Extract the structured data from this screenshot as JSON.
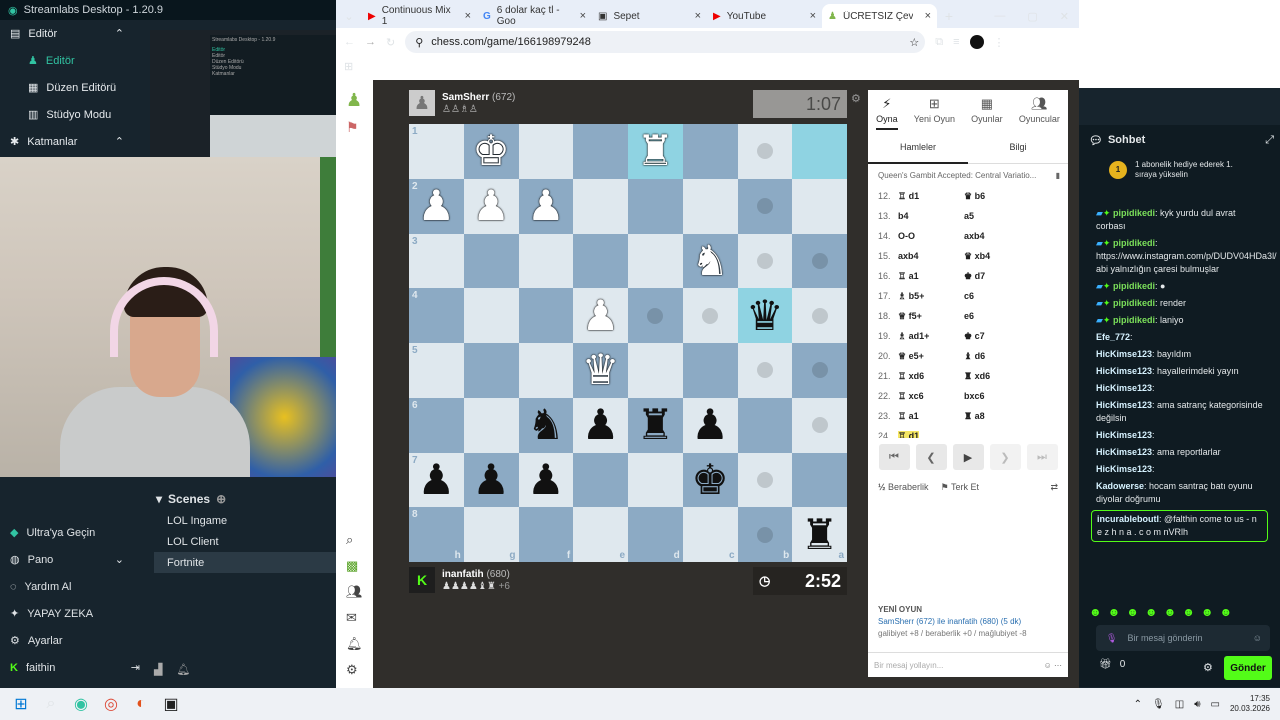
{
  "streamlabs": {
    "title": "Streamlabs Desktop - 1.20.9",
    "nav": [
      {
        "label": "Editör",
        "kind": "group",
        "icon": "editor-icon"
      },
      {
        "label": "Editör",
        "kind": "active",
        "icon": "pawn-icon"
      },
      {
        "label": "Düzen Editörü",
        "kind": "sub"
      },
      {
        "label": "Stüdyo Modu",
        "kind": "sub"
      },
      {
        "label": "Katmanlar",
        "kind": "group",
        "icon": "layers-icon"
      }
    ],
    "scenes_title": "Scenes",
    "scenes": [
      "LOL Ingame",
      "LOL Client",
      "Fortnite"
    ],
    "selected_scene": "Fortnite",
    "bottom_nav": [
      "Ultra'ya Geçin",
      "Pano",
      "Yardım Al",
      "YAPAY ZEKA",
      "Ayarlar"
    ],
    "user": "faithin",
    "preview_title": "Streamlabs Desktop - 1.20.9",
    "preview_nav": [
      "Editör",
      "Editör",
      "Düzen Editörü",
      "Stüdyo Modu",
      "Katmanlar"
    ]
  },
  "browser": {
    "tabs": [
      "Continuous Mix 1",
      "6 dolar kaç tl - Goo",
      "Sepet",
      "YouTube",
      "ÜCRETSİZ Çevrimiç"
    ],
    "active_tab": 4,
    "url": "chess.com/game/166198979248"
  },
  "chess": {
    "top_player": {
      "name": "SamSherr",
      "rating": "(672)",
      "clock": "1:07"
    },
    "bottom_player": {
      "name": "inanfatih",
      "rating": "(680)",
      "clock": "2:52",
      "advantage": "+6"
    },
    "board": [
      [
        "",
        "wk",
        "",
        "",
        "wr",
        "",
        "dot",
        "hl"
      ],
      [
        "wp",
        "wp",
        "wp",
        "",
        "",
        "",
        "dot",
        ""
      ],
      [
        "",
        "",
        "",
        "",
        "",
        "wn",
        "dot",
        "dot"
      ],
      [
        "",
        "",
        "",
        "wp",
        "dot",
        "dot",
        "bq",
        "dot"
      ],
      [
        "",
        "",
        "",
        "wq",
        "",
        "",
        "dot",
        "dot"
      ],
      [
        "",
        "",
        "bn",
        "bp",
        "br",
        "bp",
        "",
        "dot"
      ],
      [
        "bp",
        "bp",
        "bp",
        "",
        "",
        "wkb",
        "dot",
        ""
      ],
      [
        "",
        "",
        "",
        "",
        "",
        "",
        "dot",
        "br"
      ]
    ],
    "ranks": [
      "1",
      "2",
      "3",
      "4",
      "5",
      "6",
      "7",
      "8"
    ],
    "files": [
      "h",
      "g",
      "f",
      "e",
      "d",
      "c",
      "b",
      "a"
    ],
    "panel_tabs": [
      "Oyna",
      "Yeni Oyun",
      "Oyunlar",
      "Oyuncular"
    ],
    "sub_tabs": [
      "Hamleler",
      "Bilgi"
    ],
    "opening": "Queen's Gambit Accepted: Central Variatio...",
    "moves": [
      {
        "n": "12.",
        "w": "♖ d1",
        "b": "♛ b6"
      },
      {
        "n": "13.",
        "w": "b4",
        "b": "a5"
      },
      {
        "n": "14.",
        "w": "O-O",
        "b": "axb4"
      },
      {
        "n": "15.",
        "w": "axb4",
        "b": "♛ xb4"
      },
      {
        "n": "16.",
        "w": "♖ a1",
        "b": "♚ d7"
      },
      {
        "n": "17.",
        "w": "♗ b5+",
        "b": "c6"
      },
      {
        "n": "18.",
        "w": "♕ f5+",
        "b": "e6"
      },
      {
        "n": "19.",
        "w": "♗ ad1+",
        "b": "♚ c7"
      },
      {
        "n": "20.",
        "w": "♕ e5+",
        "b": "♝ d6"
      },
      {
        "n": "21.",
        "w": "♖ xd6",
        "b": "♜ xd6"
      },
      {
        "n": "22.",
        "w": "♖ xc6",
        "b": "bxc6"
      },
      {
        "n": "23.",
        "w": "♖ a1",
        "b": "♜ a8"
      },
      {
        "n": "24.",
        "w": "♖ d1",
        "b": ""
      }
    ],
    "draw": "Beraberlik",
    "resign": "Terk Et",
    "new_game_title": "YENİ OYUN",
    "new_game_line1": "SamSherr (672) ile inanfatih (680) (5 dk)",
    "new_game_line2": "galibiyet +8 / beraberlik +0 / mağlubiyet -8",
    "chat_placeholder": "Bir mesaj yollayın..."
  },
  "twitch": {
    "title": "Sohbet",
    "pinned": "1 abonelik hediye ederek 1. sıraya yükselin",
    "messages": [
      {
        "user": "pipidikedi",
        "text": ": kyk yurdu dul avrat corbası",
        "color": "g"
      },
      {
        "user": "pipidikedi",
        "text": ": https://www.instagram.com/p/DUDV04HDa3l/ abi yalnızlığın çaresi bulmuşlar",
        "color": "g"
      },
      {
        "user": "pipidikedi",
        "text": ": ●",
        "color": "g"
      },
      {
        "user": "pipidikedi",
        "text": ": render",
        "color": "g"
      },
      {
        "user": "pipidikedi",
        "text": ": laniyo",
        "color": "g"
      },
      {
        "user": "Efe_772",
        "text": ":",
        "color": "w"
      },
      {
        "user": "HicKimse123",
        "text": ": bayıldım",
        "color": "w"
      },
      {
        "user": "HicKimse123",
        "text": ": hayallerimdeki yayın",
        "color": "w"
      },
      {
        "user": "HicKimse123",
        "text": ":",
        "color": "w"
      },
      {
        "user": "HicKimse123",
        "text": ": ama satranç kategorisinde değilsin",
        "color": "w"
      },
      {
        "user": "HicKimse123",
        "text": ":",
        "color": "w"
      },
      {
        "user": "HicKimse123",
        "text": ": ama reportlarlar",
        "color": "w"
      },
      {
        "user": "HicKimse123",
        "text": ":",
        "color": "w"
      },
      {
        "user": "Kadowerse",
        "text": ": hocam santraç batı oyunu diyolar doğrumu",
        "color": "w"
      },
      {
        "user": "incurableboutl",
        "text": ": @falthin come to us - n e z h n a . c o m nVRlh",
        "color": "w"
      }
    ],
    "input_placeholder": "Bir mesaj gönderin",
    "points": "0",
    "send": "Gönder"
  },
  "taskbar": {
    "time": "17:35",
    "date": "20.03.2026"
  }
}
